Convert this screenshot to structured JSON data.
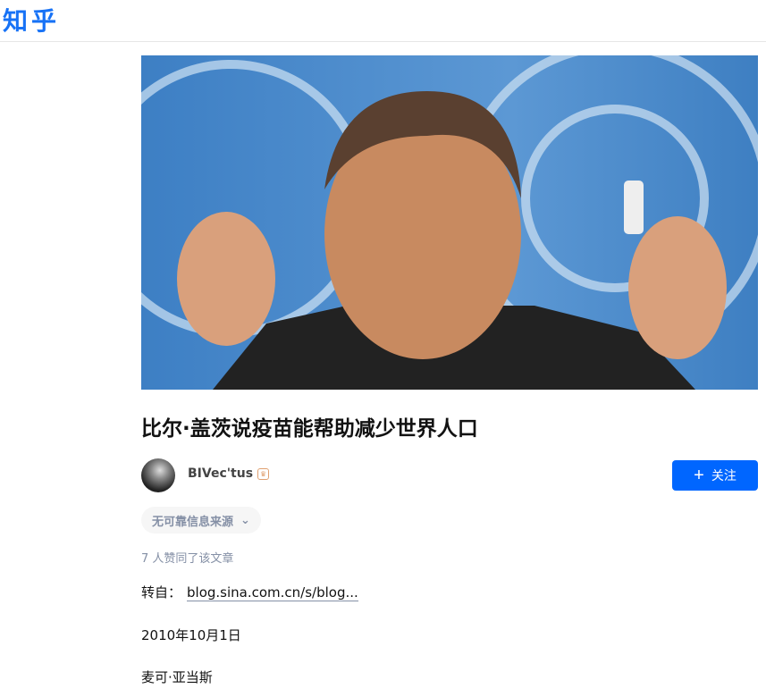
{
  "header": {
    "logo": "知乎"
  },
  "article": {
    "title": "比尔·盖茨说疫苗能帮助减少世界人口",
    "author": {
      "name": "BIVec'tus",
      "badge_icon": "crown-badge-icon"
    },
    "follow_label": "关注",
    "tag": "无可靠信息来源",
    "likes": "7 人赞同了该文章",
    "source_prefix": "转自：",
    "source_link": "blog.sina.com.cn/s/blog...",
    "paragraphs": [
      "2010年10月1日",
      "麦可·亚当斯"
    ]
  },
  "colors": {
    "brand": "#0066ff",
    "logo": "#1772f6"
  }
}
